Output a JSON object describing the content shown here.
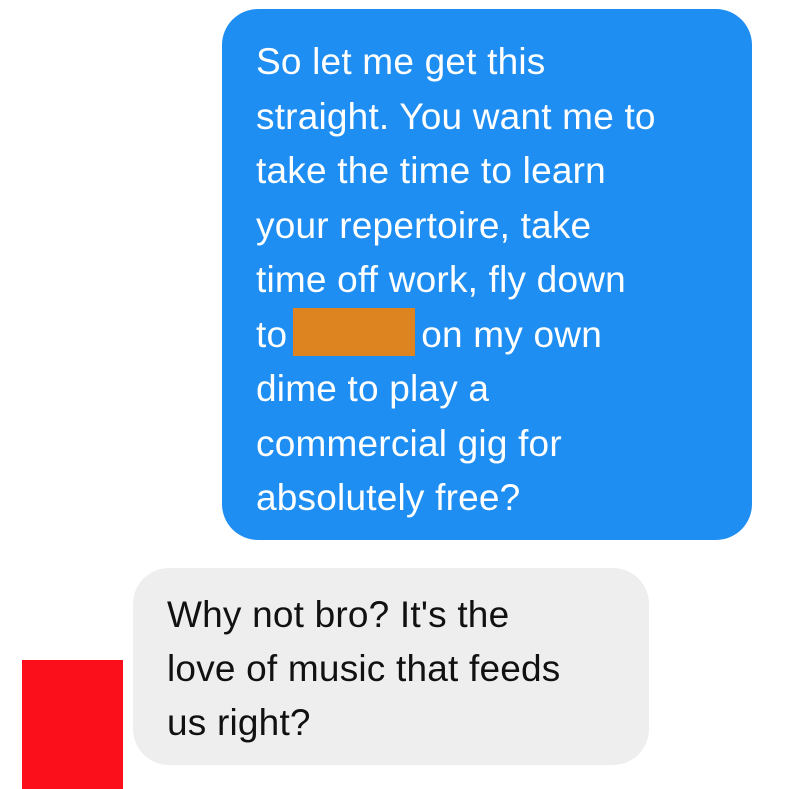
{
  "colors": {
    "outgoing_bubble": "#1f8ef2",
    "incoming_bubble": "#eeeeee",
    "outgoing_text": "#ffffff",
    "incoming_text": "#111111",
    "redaction_orange": "#dd8420",
    "redaction_red": "#fb0f1a"
  },
  "messages": [
    {
      "sender": "me",
      "lines": [
        "So let me get this",
        "straight. You want me to",
        "take the time to learn",
        "your repertoire, take",
        "time off work, fly down",
        {
          "before": "to",
          "after": "on my own"
        },
        "dime to play a",
        "commercial gig for",
        "absolutely free?"
      ]
    },
    {
      "sender": "them",
      "lines": [
        "Why not bro? It's the",
        "love of music that feeds",
        "us right?"
      ]
    }
  ]
}
